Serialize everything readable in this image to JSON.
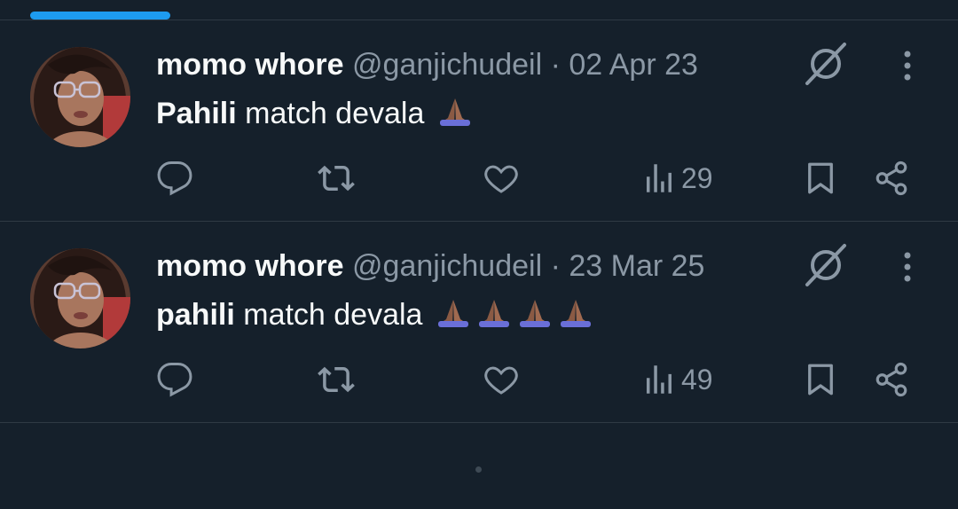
{
  "colors": {
    "background": "#15202b",
    "accent": "#1d9bf0",
    "muted": "#8b98a5",
    "divider": "#2f3a44"
  },
  "tweets": [
    {
      "name": "momo whore",
      "handle": "@ganjichudeil",
      "separator": "·",
      "date": "02 Apr 23",
      "text_bold": "Pahili",
      "text_rest": " match devala",
      "emoji": "folded-hands",
      "emoji_count": 1,
      "views": "29",
      "icons": [
        "reply-icon",
        "retweet-icon",
        "like-icon",
        "views-icon",
        "bookmark-icon",
        "share-icon",
        "grok-icon",
        "more-icon"
      ]
    },
    {
      "name": "momo whore",
      "handle": "@ganjichudeil",
      "separator": "·",
      "date": "23 Mar 25",
      "text_bold": "pahili",
      "text_rest": " match devala",
      "emoji": "folded-hands",
      "emoji_count": 4,
      "views": "49",
      "icons": [
        "reply-icon",
        "retweet-icon",
        "like-icon",
        "views-icon",
        "bookmark-icon",
        "share-icon",
        "grok-icon",
        "more-icon"
      ]
    }
  ]
}
